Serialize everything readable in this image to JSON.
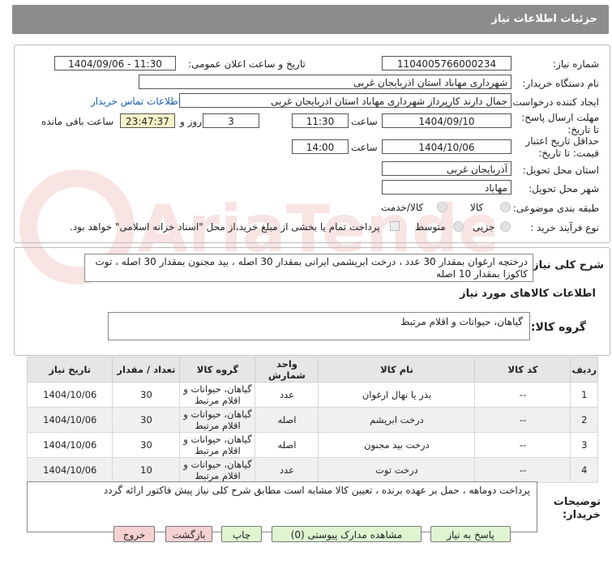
{
  "header": {
    "title": "جزئیات اطلاعات نیاز"
  },
  "form": {
    "need_number_label": "شماره نیاز:",
    "need_number_value": "1104005766000234",
    "announce_label": "تاریخ و ساعت اعلان عمومی:",
    "announce_value": "1404/09/06 - 11:30",
    "buyer_org_label": "نام دستگاه خریدار:",
    "buyer_org_value": "شهرداری مهاباد استان اذربایجان غربی",
    "creator_label": "ایجاد کننده درخواست:",
    "creator_value": "جمال دارند کارپرداز  شهرداری مهاباد استان اذربایجان غربی",
    "contact_link": "اطلاعات تماس خریدار",
    "deadline_label": "مهلت ارسال پاسخ: تا تاریخ:",
    "deadline_date": "1404/09/10",
    "time_label": "ساعت",
    "deadline_time": "11:30",
    "days_value": "3",
    "days_label": "روز و",
    "remaining_time": "23:47:37",
    "remaining_label": "ساعت باقی مانده",
    "validity_label": "حداقل تاریخ اعتبار قیمت: تا تاریخ:",
    "validity_date": "1404/10/06",
    "validity_time": "14:00",
    "province_label": "استان محل تحویل:",
    "province_value": "آذربایجان غربی",
    "city_label": "شهر محل تحویل:",
    "city_value": "مهاباد",
    "category_label": "طبقه بندی موضوعی:",
    "category_options": [
      "کالا",
      "کالا/خدمت"
    ],
    "process_label": "نوع فرآیند خرید :",
    "process_options": [
      "جزیی",
      "متوسط"
    ],
    "payment_note": "پرداخت تمام یا بخشی از مبلغ خرید،از محل \"اسناد خزانه اسلامی\" خواهد بود."
  },
  "summary": {
    "label": "شرح کلی نیاز:",
    "line1": "درختچه ارغوان بمقدار 30 عدد ، درخت ابریشمی ایرانی بمقدار 30 اصله ، بید مجنون بمقدار 30 اصله ، توت",
    "line2": "کاکوزا بمقدار 10 اصله"
  },
  "goods": {
    "section_title": "اطلاعات کالاهای مورد نیاز",
    "group_label": "گروه کالا:",
    "group_value": "گیاهان، حیوانات و اقلام مرتبط"
  },
  "table": {
    "headers": [
      "ردیف",
      "کد کالا",
      "نام کالا",
      "واحد شمارش",
      "گروه کالا",
      "تعداد / مقدار",
      "تاریخ نیاز"
    ],
    "rows": [
      [
        "1",
        "--",
        "بذر یا نهال ارغوان",
        "عدد",
        "گیاهان، حیوانات و اقلام مرتبط",
        "30",
        "1404/10/06"
      ],
      [
        "2",
        "--",
        "درخت ابریشم",
        "اصله",
        "گیاهان، حیوانات و اقلام مرتبط",
        "30",
        "1404/10/06"
      ],
      [
        "3",
        "--",
        "درخت بید مجنون",
        "اصله",
        "گیاهان، حیوانات و اقلام مرتبط",
        "30",
        "1404/10/06"
      ],
      [
        "4",
        "--",
        "درخت توت",
        "عدد",
        "گیاهان، حیوانات و اقلام مرتبط",
        "10",
        "1404/10/06"
      ]
    ]
  },
  "notes": {
    "label": "توضیحات خریدار:",
    "value": "پرداخت دوماهه ، حمل بر عهده برنده ، تعیین کالا مشابه است مطابق شرح کلی نیاز پیش فاکتور ارائه گردد"
  },
  "buttons": {
    "reply": "پاسخ به نیاز",
    "attachments": "مشاهده مدارک پیوستی (0)",
    "print": "چاپ",
    "back": "بازگشت",
    "exit": "خروج"
  },
  "watermark": {
    "text": "AriaTender.net"
  },
  "colors": {
    "header_bg": "#8c8c8c",
    "remaining_bg": "#f8f2c8",
    "button_green": "#dff5d2",
    "button_red": "#f6d2d2",
    "link": "#1a5fb4"
  }
}
